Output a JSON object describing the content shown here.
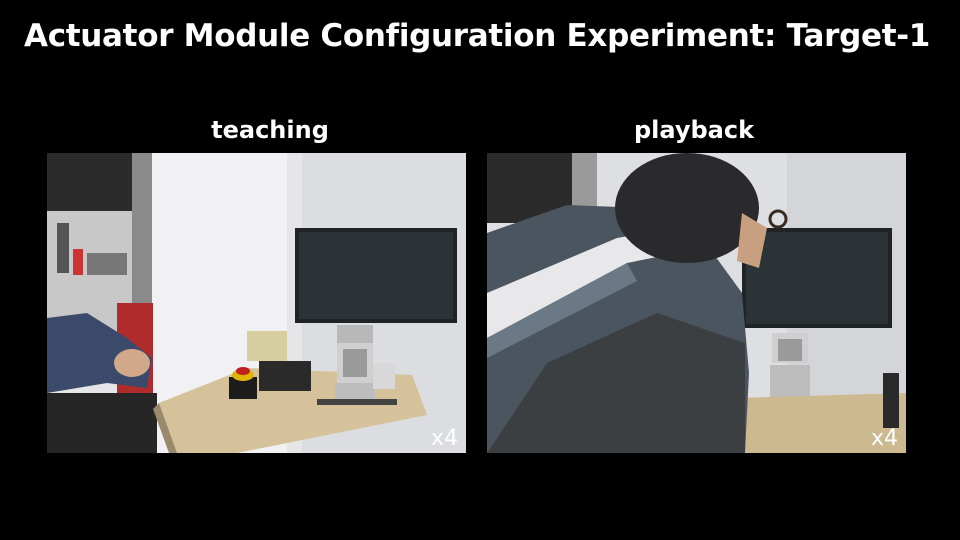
{
  "title": "Actuator Module Configuration Experiment: Target-1",
  "panels": {
    "left": {
      "label": "teaching",
      "speed": "x4"
    },
    "right": {
      "label": "playback",
      "speed": "x4"
    }
  }
}
